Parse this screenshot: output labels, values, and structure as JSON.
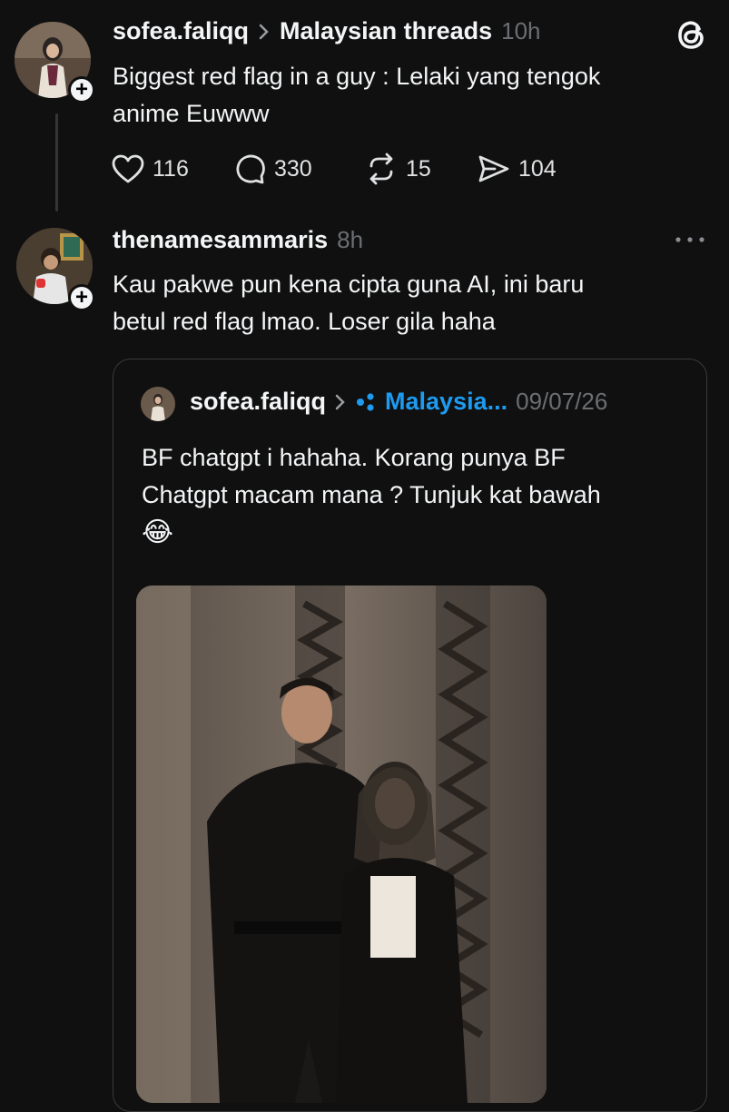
{
  "post": {
    "username": "sofea.faliqq",
    "community": "Malaysian threads",
    "time": "10h",
    "text_line1": "Biggest red flag in a guy : Lelaki yang tengok",
    "text_line2": "anime Euwww",
    "likes": "116",
    "comments": "330",
    "reposts": "15",
    "shares": "104"
  },
  "reply": {
    "username": "thenamesammaris",
    "time": "8h",
    "text_line1": "Kau pakwe pun kena cipta guna AI, ini baru",
    "text_line2": "betul red flag lmao. Loser gila haha"
  },
  "quoted": {
    "username": "sofea.faliqq",
    "community": "Malaysia...",
    "date": "09/07/26",
    "text_line1": "BF chatgpt i hahaha. Korang punya BF",
    "text_line2": "Chatgpt macam mana ? Tunjuk kat bawah",
    "emoji": "😂"
  },
  "colors": {
    "background": "#101010",
    "accent_link": "#1d9bf0",
    "muted": "#6b6f73"
  },
  "icons": [
    "threads-logo-icon",
    "heart-icon",
    "comment-icon",
    "repost-icon",
    "share-icon",
    "more-icon",
    "follow-plus-icon",
    "chevron-right-icon",
    "community-icon"
  ]
}
